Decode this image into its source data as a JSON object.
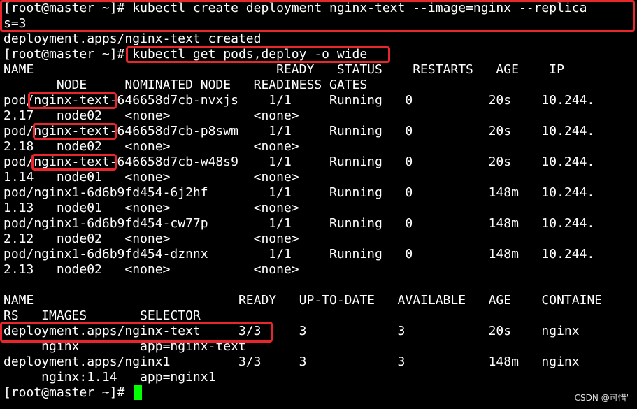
{
  "terminal": {
    "lines": [
      "[root@master ~]# kubectl create deployment nginx-text --image=nginx --replica",
      "s=3",
      "deployment.apps/nginx-text created",
      "[root@master ~]# kubectl get pods,deploy -o wide",
      "NAME                                READY   STATUS    RESTARTS   AGE    IP",
      "       NODE     NOMINATED NODE   READINESS GATES",
      "pod/nginx-text-646658d7cb-nvxjs    1/1     Running   0          20s    10.244.",
      "2.17   node02   <none>           <none>",
      "pod/nginx-text-646658d7cb-p8swm    1/1     Running   0          20s    10.244.",
      "2.18   node02   <none>           <none>",
      "pod/nginx-text-646658d7cb-w48s9    1/1     Running   0          20s    10.244.",
      "1.14   node01   <none>           <none>",
      "pod/nginx1-6d6b9fd454-6j2hf        1/1     Running   0          148m   10.244.",
      "1.13   node01   <none>           <none>",
      "pod/nginx1-6d6b9fd454-cw77p        1/1     Running   0          148m   10.244.",
      "2.12   node02   <none>           <none>",
      "pod/nginx1-6d6b9fd454-dznnx        1/1     Running   0          148m   10.244.",
      "2.13   node02   <none>           <none>",
      "",
      "NAME                           READY   UP-TO-DATE   AVAILABLE   AGE    CONTAINE",
      "RS   IMAGES       SELECTOR",
      "deployment.apps/nginx-text     3/3     3            3           20s    nginx",
      "     nginx        app=nginx-text",
      "deployment.apps/nginx1         3/3     3            3           148m   nginx",
      "     nginx:1.14   app=nginx1",
      "[root@master ~]# "
    ]
  },
  "watermark": "CSDN @可惜'",
  "colors": {
    "background": "#000000",
    "text": "#ffffff",
    "highlight_box": "#e8262b",
    "cursor": "#00ff00"
  }
}
